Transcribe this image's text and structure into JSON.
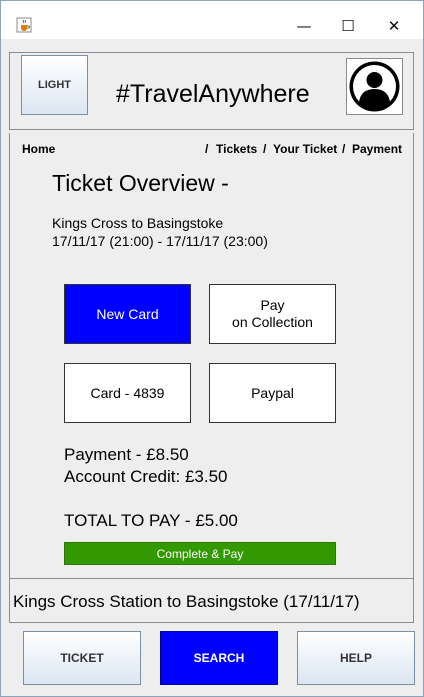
{
  "titlebar": {
    "icon": "java-cup-icon",
    "minimize_glyph": "—",
    "maximize_glyph": "☐",
    "close_glyph": "✕"
  },
  "header": {
    "theme_button_label": "LIGHT",
    "app_title": "#TravelAnywhere",
    "avatar_icon": "user-avatar-icon"
  },
  "breadcrumb": {
    "home": "Home",
    "separator": "/",
    "items": [
      "Tickets",
      "Your Ticket",
      "Payment"
    ]
  },
  "overview": {
    "title": "Ticket Overview -",
    "route": "Kings Cross to Basingstoke",
    "datetime": "17/11/17 (21:00) - 17/11/17 (23:00)"
  },
  "payment_options": [
    {
      "label": "New Card",
      "selected": true
    },
    {
      "label_line1": "Pay",
      "label_line2": "on Collection",
      "selected": false
    },
    {
      "label": "Card - 4839",
      "selected": false
    },
    {
      "label": "Paypal",
      "selected": false
    }
  ],
  "summary": {
    "payment": "Payment - £8.50",
    "account_credit": "Account Credit: £3.50",
    "total": "TOTAL TO PAY - £5.00"
  },
  "complete_button_label": "Complete & Pay",
  "journey_label": "Kings Cross Station to Basingstoke (17/11/17)",
  "bottom_nav": [
    {
      "label": "TICKET",
      "active": false
    },
    {
      "label": "SEARCH",
      "active": true
    },
    {
      "label": "HELP",
      "active": false
    }
  ],
  "colors": {
    "selected_blue": "#0000ff",
    "complete_green": "#339900",
    "window_bg": "#eeeeee"
  }
}
